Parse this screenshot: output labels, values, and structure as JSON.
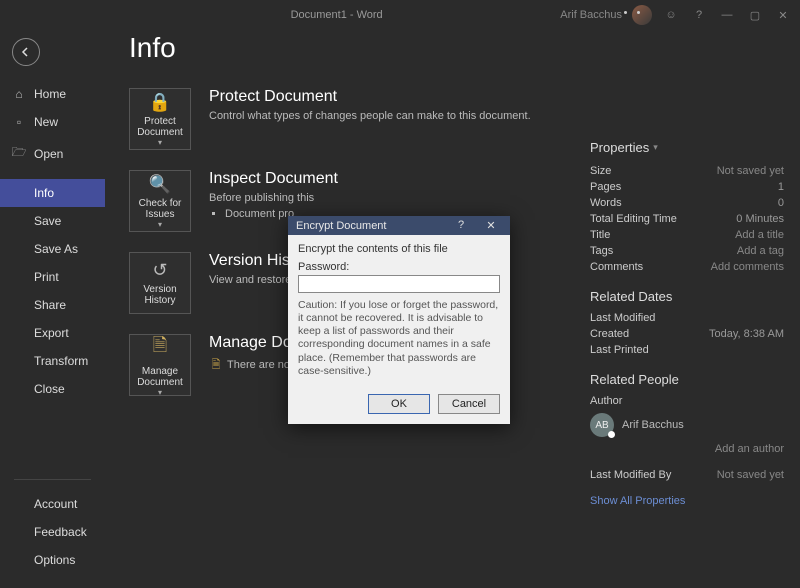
{
  "titlebar": {
    "doc_title": "Document1 - Word",
    "user_name": "Arif Bacchus"
  },
  "sidebar": {
    "items": [
      {
        "label": "Home"
      },
      {
        "label": "New"
      },
      {
        "label": "Open"
      },
      {
        "label": "Info"
      },
      {
        "label": "Save"
      },
      {
        "label": "Save As"
      },
      {
        "label": "Print"
      },
      {
        "label": "Share"
      },
      {
        "label": "Export"
      },
      {
        "label": "Transform"
      },
      {
        "label": "Close"
      }
    ],
    "bottom": [
      {
        "label": "Account"
      },
      {
        "label": "Feedback"
      },
      {
        "label": "Options"
      }
    ]
  },
  "page": {
    "title": "Info"
  },
  "sections": {
    "protect": {
      "tile": "Protect Document",
      "heading": "Protect Document",
      "desc": "Control what types of changes people can make to this document."
    },
    "inspect": {
      "tile": "Check for Issues",
      "heading": "Inspect Document",
      "desc_lead": "Before publishing this",
      "bullet": "Document pro"
    },
    "version": {
      "tile": "Version History",
      "heading": "Version History",
      "desc": "View and restore pr"
    },
    "manage": {
      "tile": "Manage Document",
      "heading": "Manage Document",
      "desc": "There are no unsaved changes."
    }
  },
  "properties": {
    "heading": "Properties",
    "rows": {
      "size_k": "Size",
      "size_v": "Not saved yet",
      "pages_k": "Pages",
      "pages_v": "1",
      "words_k": "Words",
      "words_v": "0",
      "time_k": "Total Editing Time",
      "time_v": "0 Minutes",
      "title_k": "Title",
      "title_v": "Add a title",
      "tags_k": "Tags",
      "tags_v": "Add a tag",
      "comments_k": "Comments",
      "comments_v": "Add comments"
    },
    "dates": {
      "heading": "Related Dates",
      "lastmod_k": "Last Modified",
      "created_k": "Created",
      "created_v": "Today, 8:38 AM",
      "lastprint_k": "Last Printed"
    },
    "people": {
      "heading": "Related People",
      "author_k": "Author",
      "author_initials": "AB",
      "author_name": "Arif Bacchus",
      "add_author": "Add an author",
      "lastby_k": "Last Modified By",
      "lastby_v": "Not saved yet"
    },
    "show_all": "Show All Properties"
  },
  "dialog": {
    "title": "Encrypt Document",
    "instr": "Encrypt the contents of this file",
    "pw_label": "Password:",
    "caution": "Caution: If you lose or forget the password, it cannot be recovered. It is advisable to keep a list of passwords and their corresponding document names in a safe place. (Remember that passwords are case-sensitive.)",
    "ok": "OK",
    "cancel": "Cancel"
  }
}
